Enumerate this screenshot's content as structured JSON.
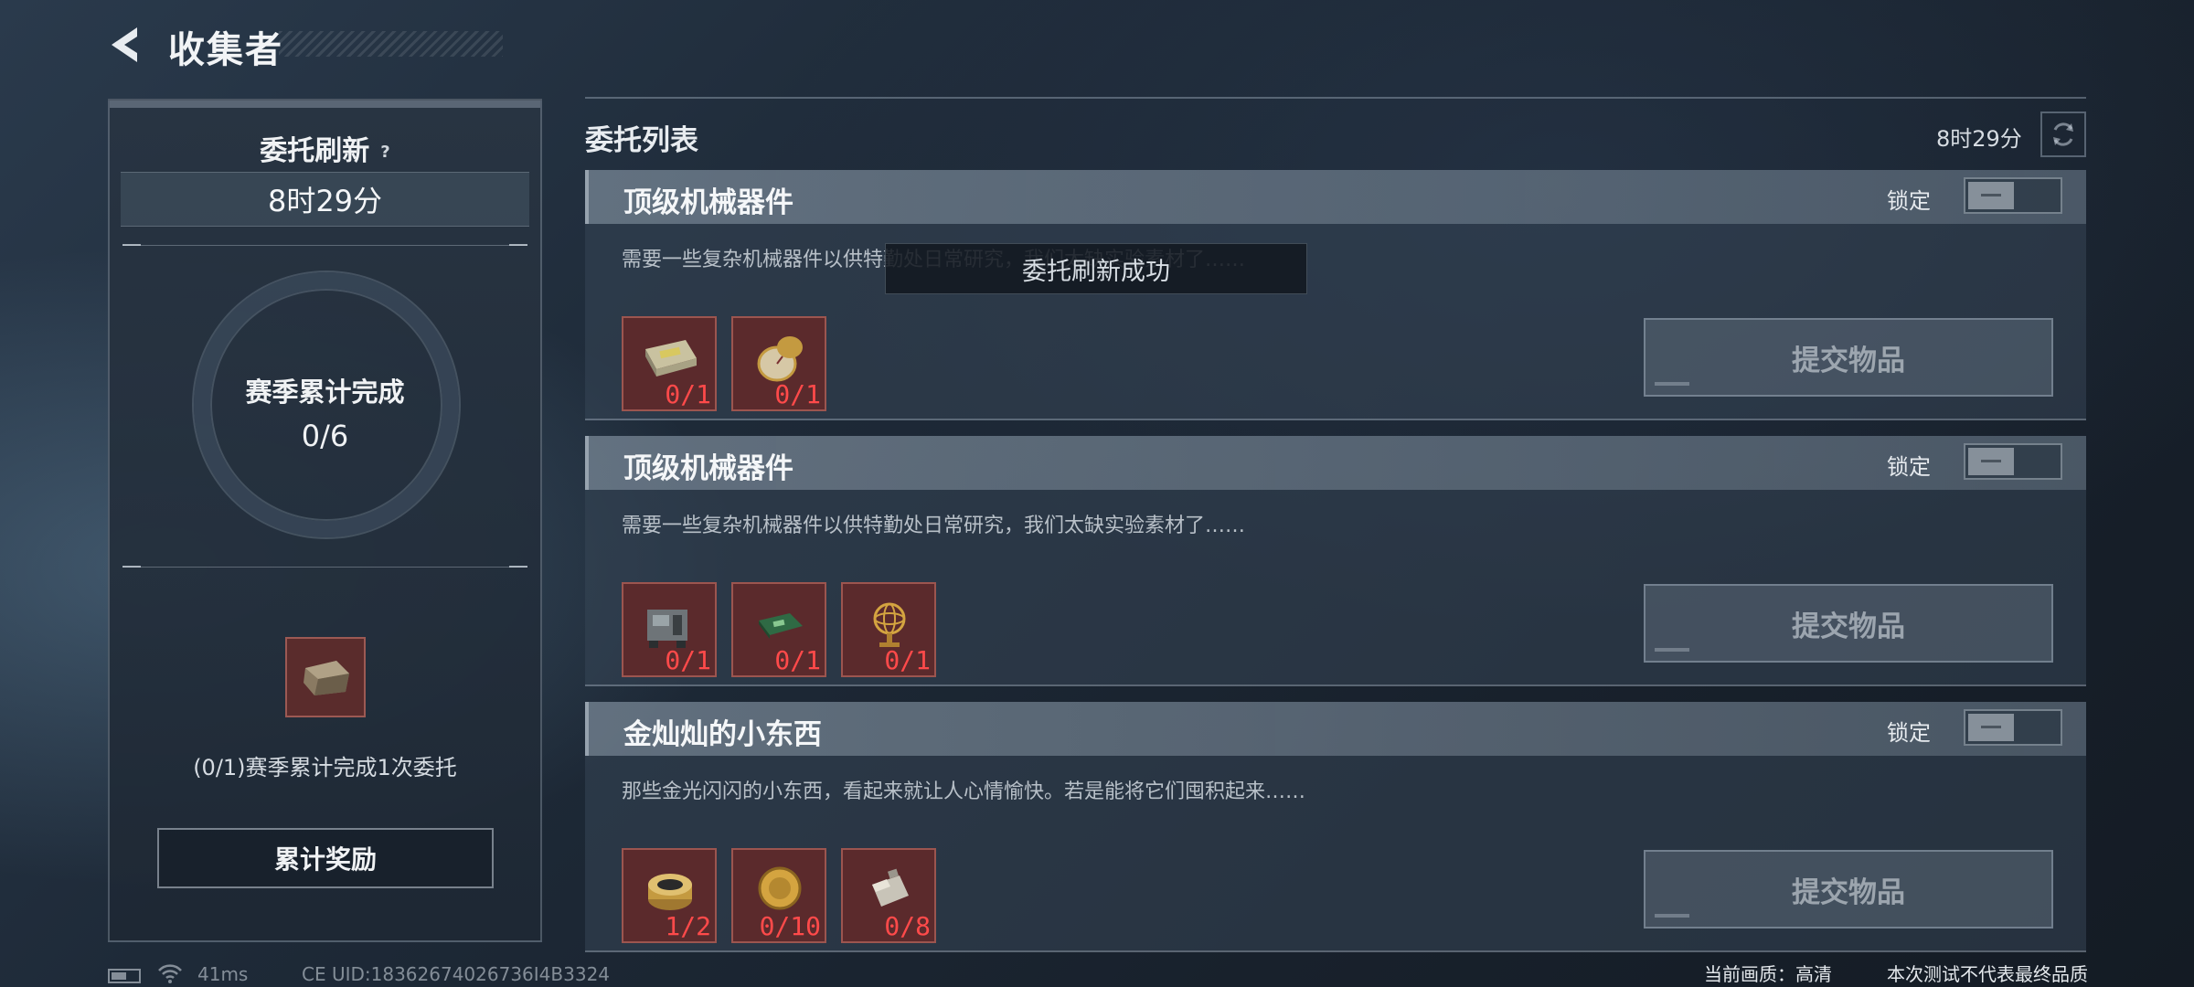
{
  "header": {
    "title": "收集者"
  },
  "left_panel": {
    "refresh_title": "委托刷新",
    "refresh_timer": "8时29分",
    "season_label": "赛季累计完成",
    "season_progress": "0/6",
    "reward_desc": "(0/1)赛季累计完成1次委托",
    "cumulative_reward_button": "累计奖励"
  },
  "list": {
    "title": "委托列表",
    "timer": "8时29分",
    "tasks": [
      {
        "title": "顶级机械器件",
        "lock_label": "锁定",
        "desc": "需要一些复杂机械器件以供特勤处日常研究，我们太缺实验素材了……",
        "items": [
          {
            "icon": "circuit-board-icon",
            "count": "0/1"
          },
          {
            "icon": "pocket-watch-icon",
            "count": "0/1"
          }
        ],
        "submit_label": "提交物品"
      },
      {
        "title": "顶级机械器件",
        "lock_label": "锁定",
        "desc": "需要一些复杂机械器件以供特勤处日常研究，我们太缺实验素材了……",
        "items": [
          {
            "icon": "radio-device-icon",
            "count": "0/1"
          },
          {
            "icon": "green-chip-icon",
            "count": "0/1"
          },
          {
            "icon": "armillary-sphere-icon",
            "count": "0/1"
          }
        ],
        "submit_label": "提交物品"
      },
      {
        "title": "金灿灿的小东西",
        "lock_label": "锁定",
        "desc": "那些金光闪闪的小东西，看起来就让人心情愉快。若是能将它们囤积起来……",
        "items": [
          {
            "icon": "gold-tin-icon",
            "count": "1/2"
          },
          {
            "icon": "gold-coin-icon",
            "count": "0/10"
          },
          {
            "icon": "lighter-icon",
            "count": "0/8"
          }
        ],
        "submit_label": "提交物品"
      }
    ]
  },
  "toast": "委托刷新成功",
  "footer": {
    "ping": "41ms",
    "uid": "CE UID:18362674026736I4B3324",
    "quality": "当前画质：高清",
    "disclaimer": "本次测试不代表最终品质"
  }
}
